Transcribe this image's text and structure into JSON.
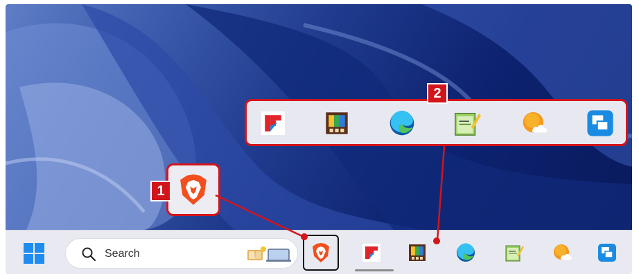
{
  "taskbar": {
    "search": {
      "label": "Search"
    },
    "start_icon": "windows-logo-icon",
    "items": [
      {
        "name": "brave",
        "icon": "brave-lion-icon",
        "state": "active"
      },
      {
        "name": "flipboard",
        "icon": "flipboard-icon",
        "state": "running"
      },
      {
        "name": "media-app",
        "icon": "tv-icon",
        "state": "pinned"
      },
      {
        "name": "edge",
        "icon": "edge-icon",
        "state": "pinned"
      },
      {
        "name": "editor",
        "icon": "notepad-icon",
        "state": "pinned"
      },
      {
        "name": "weather",
        "icon": "weather-icon",
        "state": "pinned"
      },
      {
        "name": "windows-app",
        "icon": "windows-app-icon",
        "state": "pinned"
      }
    ]
  },
  "popup": {
    "items": [
      "flipboard-icon",
      "tv-icon",
      "edge-icon",
      "notepad-icon",
      "weather-icon",
      "windows-app-icon"
    ]
  },
  "callouts": {
    "badge1": "1",
    "badge2": "2"
  },
  "colors": {
    "highlight": "#d2151b",
    "taskbar": "#e9eaf1",
    "wallpaper_dark": "#0d2270",
    "wallpaper_light": "#5f7ec6"
  }
}
